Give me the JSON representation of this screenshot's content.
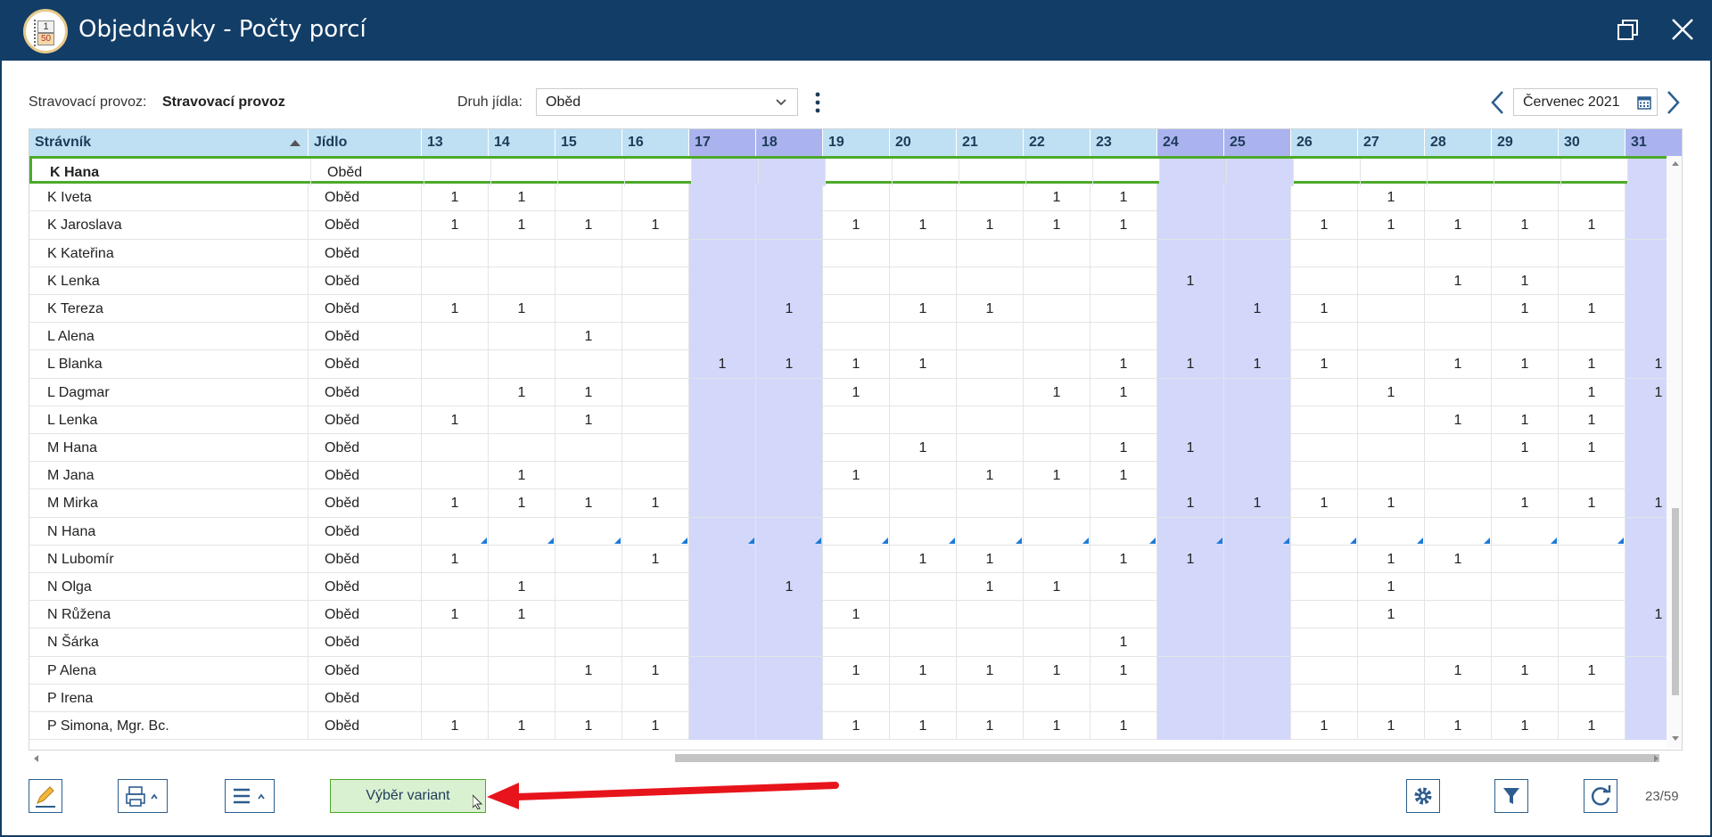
{
  "window": {
    "title": "Objednávky - Počty porcí",
    "logo_top": "1",
    "logo_bottom": "50"
  },
  "filters": {
    "provoz_label": "Stravovací provoz:",
    "provoz_value": "Stravovací provoz",
    "druh_label": "Druh jídla:",
    "druh_value": "Oběd",
    "month": "Červenec 2021"
  },
  "grid": {
    "headers": {
      "name": "Strávník",
      "food": "Jídlo"
    },
    "days": [
      "13",
      "14",
      "15",
      "16",
      "17",
      "18",
      "19",
      "20",
      "21",
      "22",
      "23",
      "24",
      "25",
      "26",
      "27",
      "28",
      "29",
      "30",
      "31"
    ],
    "weekend_days": [
      "17",
      "18",
      "24",
      "25",
      "31"
    ],
    "rows": [
      {
        "name": "K Hana",
        "food": "Oběd",
        "vals": [
          "",
          "",
          "",
          "",
          "",
          "",
          "",
          "",
          "",
          "",
          "",
          "",
          "",
          "",
          "",
          "",
          "",
          "",
          ""
        ]
      },
      {
        "name": "K Iveta",
        "food": "Oběd",
        "vals": [
          "1",
          "1",
          "",
          "",
          "",
          "",
          "",
          "",
          "",
          "1",
          "1",
          "",
          "",
          "",
          "1",
          "",
          "",
          "",
          ""
        ]
      },
      {
        "name": "K Jaroslava",
        "food": "Oběd",
        "vals": [
          "1",
          "1",
          "1",
          "1",
          "",
          "",
          "1",
          "1",
          "1",
          "1",
          "1",
          "",
          "",
          "1",
          "1",
          "1",
          "1",
          "1",
          ""
        ]
      },
      {
        "name": "K Kateřina",
        "food": "Oběd",
        "vals": [
          "",
          "",
          "",
          "",
          "",
          "",
          "",
          "",
          "",
          "",
          "",
          "",
          "",
          "",
          "",
          "",
          "",
          "",
          ""
        ]
      },
      {
        "name": "K Lenka",
        "food": "Oběd",
        "vals": [
          "",
          "",
          "",
          "",
          "",
          "",
          "",
          "",
          "",
          "",
          "",
          "1",
          "",
          "",
          "",
          "1",
          "1",
          "",
          ""
        ]
      },
      {
        "name": "K Tereza",
        "food": "Oběd",
        "vals": [
          "1",
          "1",
          "",
          "",
          "",
          "1",
          "",
          "1",
          "1",
          "",
          "",
          "",
          "1",
          "1",
          "",
          "",
          "1",
          "1",
          ""
        ]
      },
      {
        "name": "L Alena",
        "food": "Oběd",
        "vals": [
          "",
          "",
          "1",
          "",
          "",
          "",
          "",
          "",
          "",
          "",
          "",
          "",
          "",
          "",
          "",
          "",
          "",
          "",
          ""
        ]
      },
      {
        "name": "L Blanka",
        "food": "Oběd",
        "vals": [
          "",
          "",
          "",
          "",
          "1",
          "1",
          "1",
          "1",
          "",
          "",
          "1",
          "1",
          "1",
          "1",
          "",
          "1",
          "1",
          "1",
          "1"
        ]
      },
      {
        "name": "L Dagmar",
        "food": "Oběd",
        "vals": [
          "",
          "1",
          "1",
          "",
          "",
          "",
          "1",
          "",
          "",
          "1",
          "1",
          "",
          "",
          "",
          "1",
          "",
          "",
          "1",
          "1"
        ]
      },
      {
        "name": "L Lenka",
        "food": "Oběd",
        "vals": [
          "1",
          "",
          "1",
          "",
          "",
          "",
          "",
          "",
          "",
          "",
          "",
          "",
          "",
          "",
          "",
          "1",
          "1",
          "1",
          ""
        ]
      },
      {
        "name": "M Hana",
        "food": "Oběd",
        "vals": [
          "",
          "",
          "",
          "",
          "",
          "",
          "",
          "1",
          "",
          "",
          "1",
          "1",
          "",
          "",
          "",
          "",
          "1",
          "1",
          ""
        ]
      },
      {
        "name": "M Jana",
        "food": "Oběd",
        "vals": [
          "",
          "1",
          "",
          "",
          "",
          "",
          "1",
          "",
          "1",
          "1",
          "1",
          "",
          "",
          "",
          "",
          "",
          "",
          "",
          ""
        ]
      },
      {
        "name": "M Mirka",
        "food": "Oběd",
        "vals": [
          "1",
          "1",
          "1",
          "1",
          "",
          "",
          "",
          "",
          "",
          "",
          "",
          "1",
          "1",
          "1",
          "1",
          "",
          "1",
          "1",
          "1"
        ]
      },
      {
        "name": "N Hana",
        "food": "Oběd",
        "vals": [
          "",
          "",
          "",
          "",
          "",
          "",
          "",
          "",
          "",
          "",
          "",
          "",
          "",
          "",
          "",
          "",
          "",
          "",
          ""
        ],
        "marked": true
      },
      {
        "name": "N Lubomír",
        "food": "Oběd",
        "vals": [
          "1",
          "",
          "",
          "1",
          "",
          "",
          "",
          "1",
          "1",
          "",
          "1",
          "1",
          "",
          "",
          "1",
          "1",
          "",
          "",
          ""
        ]
      },
      {
        "name": "N Olga",
        "food": "Oběd",
        "vals": [
          "",
          "1",
          "",
          "",
          "",
          "1",
          "",
          "",
          "1",
          "1",
          "",
          "",
          "",
          "",
          "1",
          "",
          "",
          "",
          ""
        ]
      },
      {
        "name": "N Růžena",
        "food": "Oběd",
        "vals": [
          "1",
          "1",
          "",
          "",
          "",
          "",
          "1",
          "",
          "",
          "",
          "",
          "",
          "",
          "",
          "1",
          "",
          "",
          "",
          "1"
        ]
      },
      {
        "name": "N Šárka",
        "food": "Oběd",
        "vals": [
          "",
          "",
          "",
          "",
          "",
          "",
          "",
          "",
          "",
          "",
          "1",
          "",
          "",
          "",
          "",
          "",
          "",
          "",
          ""
        ]
      },
      {
        "name": "P Alena",
        "food": "Oběd",
        "vals": [
          "",
          "",
          "1",
          "1",
          "",
          "",
          "1",
          "1",
          "1",
          "1",
          "1",
          "",
          "",
          "",
          "",
          "1",
          "1",
          "1",
          ""
        ]
      },
      {
        "name": "P Irena",
        "food": "Oběd",
        "vals": [
          "",
          "",
          "",
          "",
          "",
          "",
          "",
          "",
          "",
          "",
          "",
          "",
          "",
          "",
          "",
          "",
          "",
          "",
          ""
        ]
      },
      {
        "name": "P Simona, Mgr. Bc.",
        "food": "Oběd",
        "vals": [
          "1",
          "1",
          "1",
          "1",
          "",
          "",
          "1",
          "1",
          "1",
          "1",
          "1",
          "",
          "",
          "1",
          "1",
          "1",
          "1",
          "1",
          ""
        ]
      }
    ]
  },
  "toolbar": {
    "variant_label": "Výběr variant",
    "counter": "23/59"
  },
  "colors": {
    "titlebar": "#123d66",
    "header": "#bfe0f3",
    "weekend_header": "#aab3ee",
    "weekend_cell": "#d3d8fa",
    "selection": "#4caa2a",
    "arrow": "#e8141b"
  }
}
